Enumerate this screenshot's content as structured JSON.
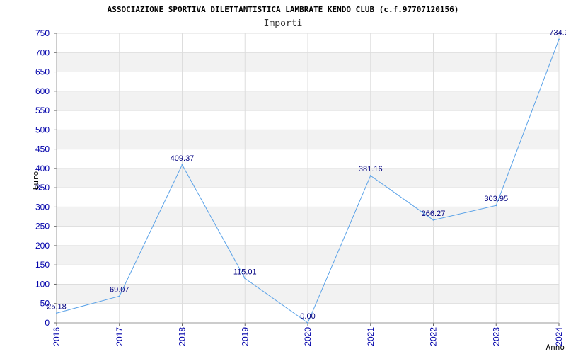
{
  "chart_data": {
    "type": "line",
    "title": "ASSOCIAZIONE SPORTIVA DILETTANTISTICA LAMBRATE KENDO CLUB (c.f.97707120156)",
    "subtitle": "Importi",
    "xlabel": "Anno",
    "ylabel": "Euro",
    "categories": [
      "2016",
      "2017",
      "2018",
      "2019",
      "2020",
      "2021",
      "2022",
      "2023",
      "2024"
    ],
    "values": [
      25.18,
      69.07,
      409.37,
      115.01,
      0.0,
      381.16,
      266.27,
      303.95,
      734.3
    ],
    "data_labels": [
      "25.18",
      "69.07",
      "409.37",
      "115.01",
      "0.00",
      "381.16",
      "266.27",
      "303.95",
      "734.3"
    ],
    "ylim": [
      0,
      750
    ],
    "yticks": [
      "0",
      "50",
      "100",
      "150",
      "200",
      "250",
      "300",
      "350",
      "400",
      "450",
      "500",
      "550",
      "600",
      "650",
      "700",
      "750"
    ],
    "grid": true,
    "colors": {
      "line": "#5aa2e8",
      "band": "#f2f2f2",
      "grid": "#dddddd",
      "tick": "#0000aa",
      "label": "#000080"
    }
  }
}
